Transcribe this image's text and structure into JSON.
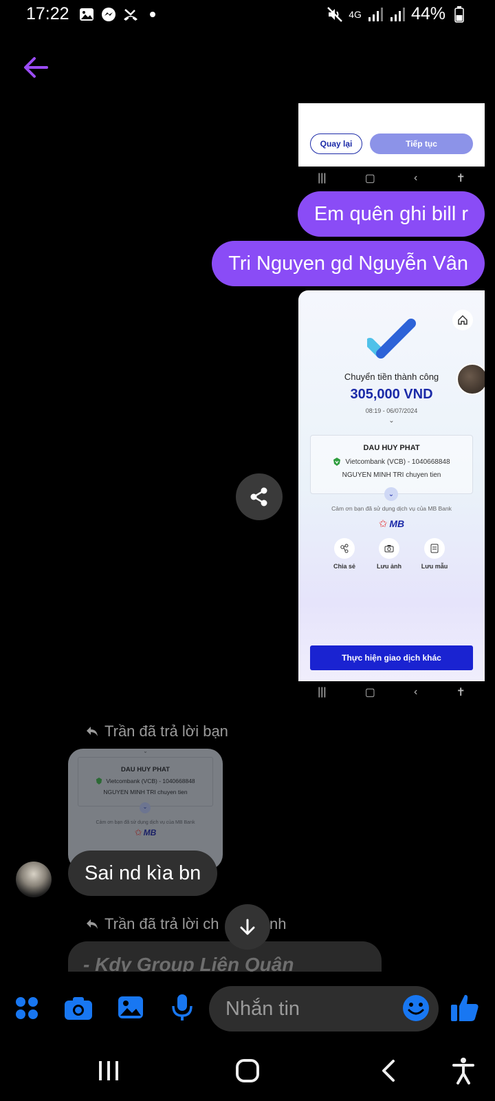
{
  "status_bar": {
    "time": "17:22",
    "network": "4G",
    "battery": "44%"
  },
  "chat": {
    "messages_out": [
      "Em quên ghi bill r",
      "Tri Nguyen gd Nguyễn Vân"
    ],
    "top_screenshot": {
      "back_button": "Quay lại",
      "continue_button": "Tiếp tục"
    },
    "receipt": {
      "title": "Chuyển tiền thành công",
      "amount": "305,000 VND",
      "datetime": "08:19 - 06/07/2024",
      "recipient_name": "DAU HUY PHAT",
      "recipient_bank": "Vietcombank (VCB) - 1040668848",
      "memo": "NGUYEN MINH TRI chuyen tien",
      "thanks": "Cảm ơn bạn đã sử dụng dịch vụ của MB Bank",
      "brand": "MB",
      "actions": [
        "Chia sẻ",
        "Lưu ảnh",
        "Lưu mẫu"
      ],
      "primary_button": "Thực hiện giao dịch khác"
    },
    "reply1": {
      "label": "Trần đã trả lời bạn",
      "quoted": {
        "recipient_name": "DAU HUY PHAT",
        "recipient_bank": "Vietcombank (VCB) - 1040668848",
        "memo": "NGUYEN MINH TRI chuyen tien",
        "thanks": "Cảm ơn bạn đã sử dụng dịch vụ của MB Bank",
        "brand": "MB"
      },
      "message": "Sai nd kìa bn"
    },
    "reply2": {
      "label_start": "Trần đã trả lời ch",
      "label_end": "nh",
      "quoted_text": "-   Kdy Group Liên Quân"
    }
  },
  "composer": {
    "placeholder": "Nhắn tin"
  },
  "colors": {
    "accent_purple": "#8a4cf6",
    "messenger_blue": "#1877f2",
    "mb_blue": "#1b2aa8"
  }
}
